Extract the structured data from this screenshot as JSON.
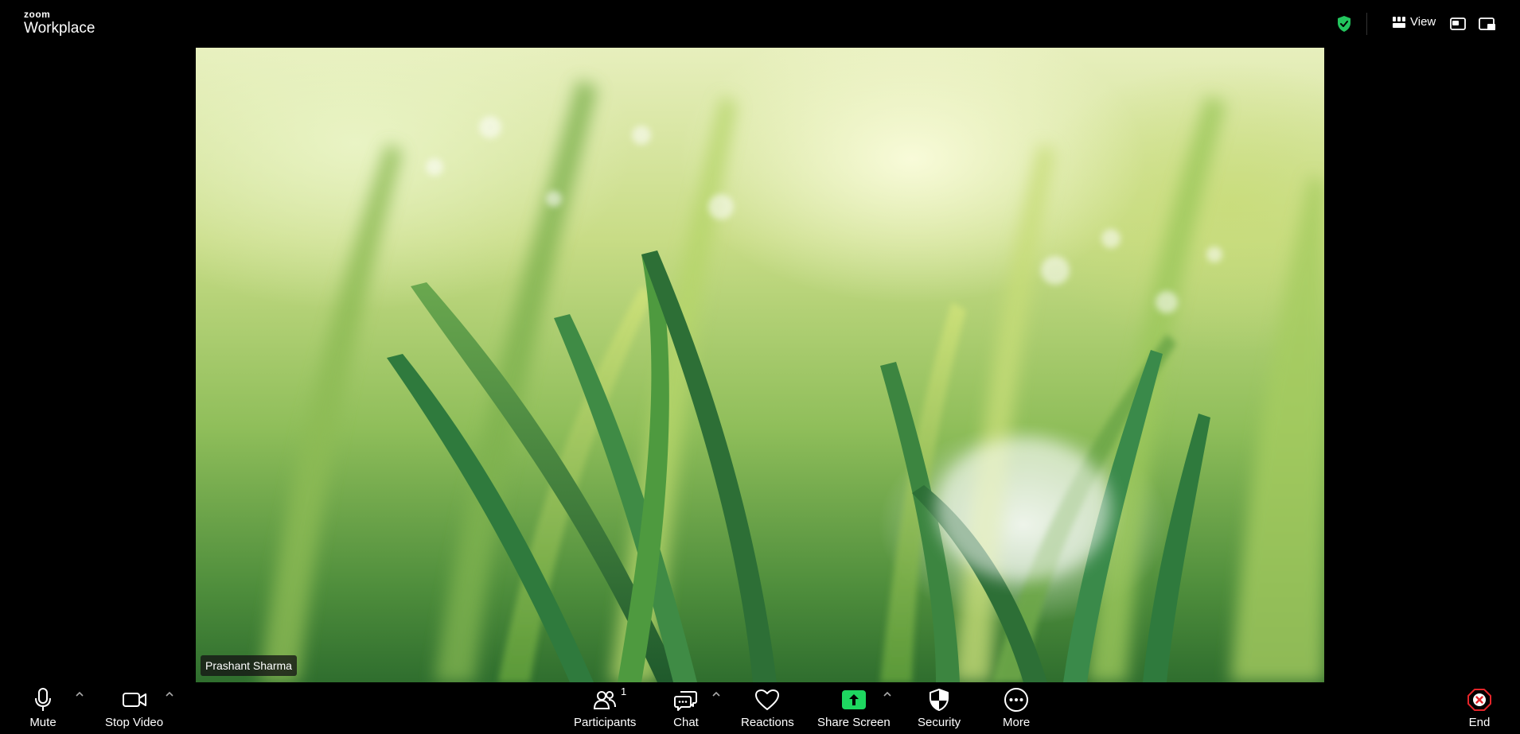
{
  "brand": {
    "small": "zoom",
    "large": "Workplace"
  },
  "topbar": {
    "view_label": "View"
  },
  "video": {
    "participant_name": "Prashant Sharma"
  },
  "toolbar": {
    "mute_label": "Mute",
    "stop_video_label": "Stop Video",
    "participants_label": "Participants",
    "participants_count": "1",
    "chat_label": "Chat",
    "reactions_label": "Reactions",
    "share_screen_label": "Share Screen",
    "security_label": "Security",
    "more_label": "More",
    "end_label": "End"
  },
  "colors": {
    "background": "#000000",
    "encryption_green": "#23c55e",
    "share_green": "#1ed760",
    "end_red": "#e5252a"
  },
  "icons": {
    "encryption": "shield-check-icon",
    "view": "grid-icon",
    "pip": "picture-in-picture-icon",
    "minimize": "minimize-window-icon",
    "mute": "microphone-icon",
    "video": "video-camera-icon",
    "participants": "people-icon",
    "chat": "chat-bubble-icon",
    "reactions": "heart-icon",
    "share": "share-arrow-icon",
    "security": "shield-icon",
    "more": "ellipsis-icon",
    "end": "close-icon"
  }
}
